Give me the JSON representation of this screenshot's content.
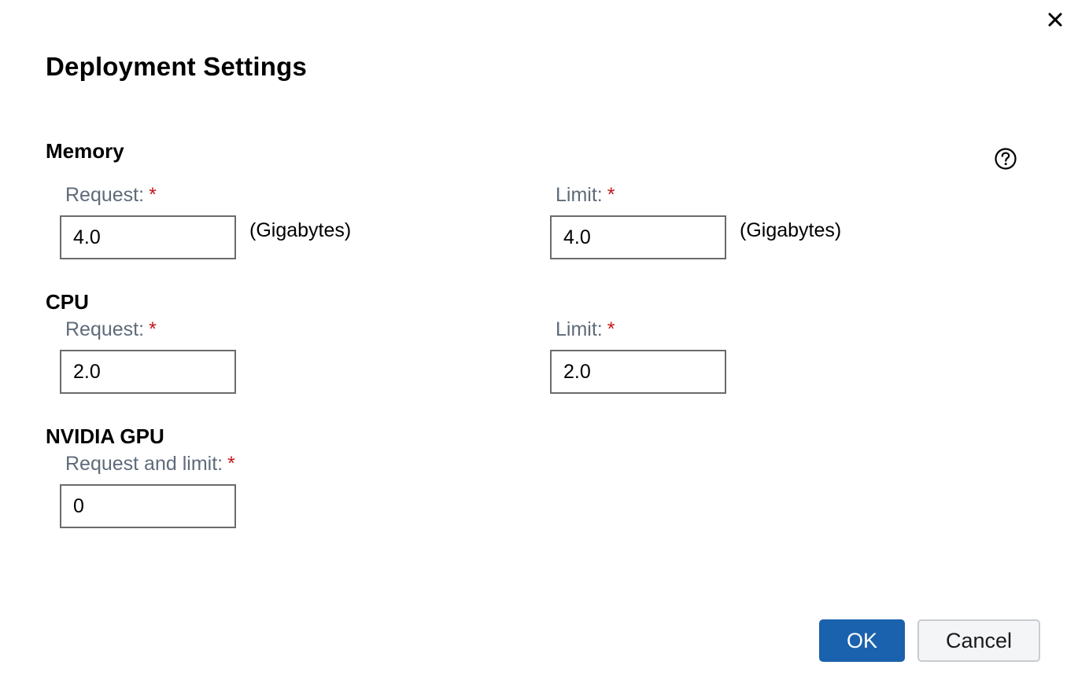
{
  "dialog": {
    "title": "Deployment Settings",
    "close_icon": "close-icon",
    "help_icon": "question-circle-icon"
  },
  "memory": {
    "heading": "Memory",
    "request_label": "Request:",
    "request_value": "4.0",
    "request_unit": "(Gigabytes)",
    "limit_label": "Limit:",
    "limit_value": "4.0",
    "limit_unit": "(Gigabytes)"
  },
  "cpu": {
    "heading": "CPU",
    "request_label": "Request:",
    "request_value": "2.0",
    "limit_label": "Limit:",
    "limit_value": "2.0"
  },
  "gpu": {
    "heading": "NVIDIA GPU",
    "request_limit_label": "Request and limit:",
    "request_limit_value": "0"
  },
  "required_marker": "*",
  "buttons": {
    "ok": "OK",
    "cancel": "Cancel"
  },
  "colors": {
    "primary": "#1a62ad",
    "required": "#c4161c",
    "label": "#5f6b7a"
  }
}
